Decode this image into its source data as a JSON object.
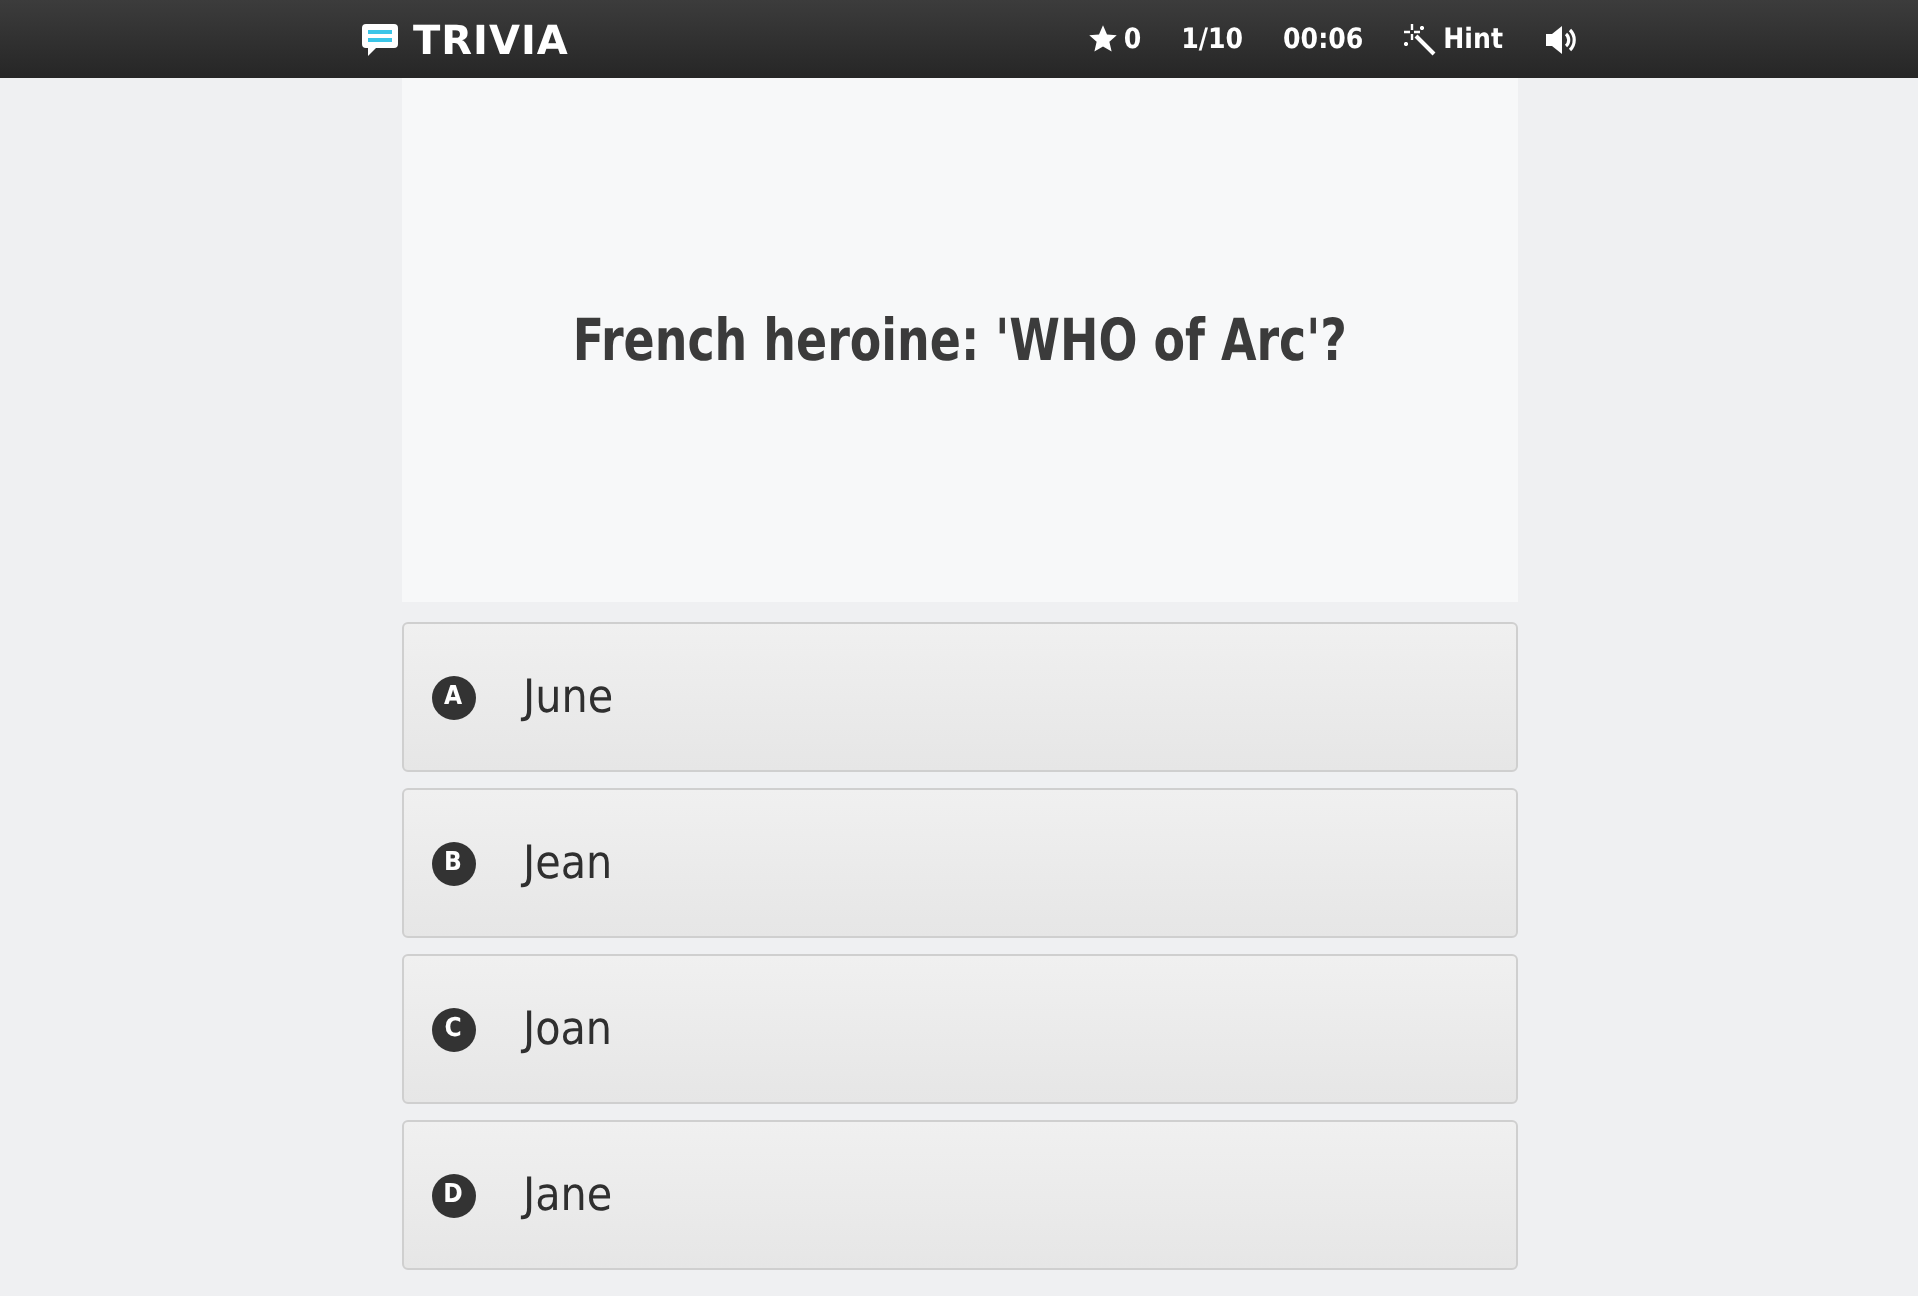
{
  "header": {
    "logo": "TRIVIA",
    "score": "0",
    "progress": "1/10",
    "timer": "00:06",
    "hint": "Hint"
  },
  "question": "French heroine: 'WHO of Arc'?",
  "answers": [
    {
      "letter": "A",
      "text": "June"
    },
    {
      "letter": "B",
      "text": "Jean"
    },
    {
      "letter": "C",
      "text": "Joan"
    },
    {
      "letter": "D",
      "text": "Jane"
    }
  ]
}
